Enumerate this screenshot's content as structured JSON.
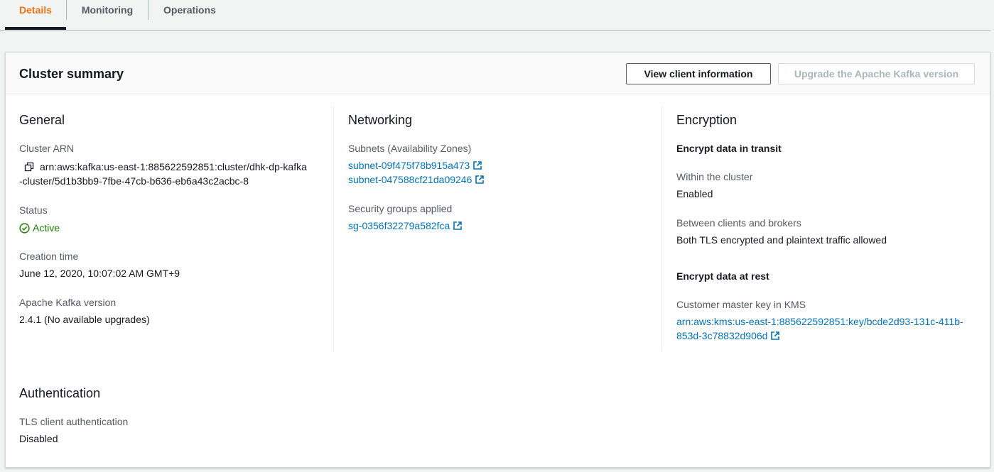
{
  "tabs": [
    {
      "label": "Details",
      "active": true
    },
    {
      "label": "Monitoring",
      "active": false
    },
    {
      "label": "Operations",
      "active": false
    }
  ],
  "panel": {
    "title": "Cluster summary",
    "view_client_label": "View client information",
    "upgrade_label": "Upgrade the Apache Kafka version"
  },
  "general": {
    "title": "General",
    "arn_key": "Cluster ARN",
    "arn_line1": "arn:aws:kafka:us-east-1:885622592851:cluster/dhk-dp-kafka",
    "arn_line2": "-cluster/5d1b3bb9-7fbe-47cb-b636-eb6a43c2acbc-8",
    "status_key": "Status",
    "status_value": "Active",
    "creation_key": "Creation time",
    "creation_value": "June 12, 2020, 10:07:02 AM GMT+9",
    "kafka_key": "Apache Kafka version",
    "kafka_value": "2.4.1 (No available upgrades)"
  },
  "networking": {
    "title": "Networking",
    "subnets_key": "Subnets (Availability Zones)",
    "subnets": [
      "subnet-09f475f78b915a473",
      "subnet-047588cf21da09246"
    ],
    "sg_key": "Security groups applied",
    "sg_value": "sg-0356f32279a582fca"
  },
  "encryption": {
    "title": "Encryption",
    "transit_title": "Encrypt data in transit",
    "within_key": "Within the cluster",
    "within_value": "Enabled",
    "between_key": "Between clients and brokers",
    "between_value": "Both TLS encrypted and plaintext traffic allowed",
    "rest_title": "Encrypt data at rest",
    "kms_key": "Customer master key in KMS",
    "kms_line1": "arn:aws:kms:us-east-1:885622592851:key/bcde2d93-131c-411b-",
    "kms_line2": "853d-3c78832d906d"
  },
  "authentication": {
    "title": "Authentication",
    "tls_key": "TLS client authentication",
    "tls_value": "Disabled"
  },
  "colors": {
    "accent": "#ec7211",
    "link": "#0073bb",
    "success": "#1d8102"
  }
}
